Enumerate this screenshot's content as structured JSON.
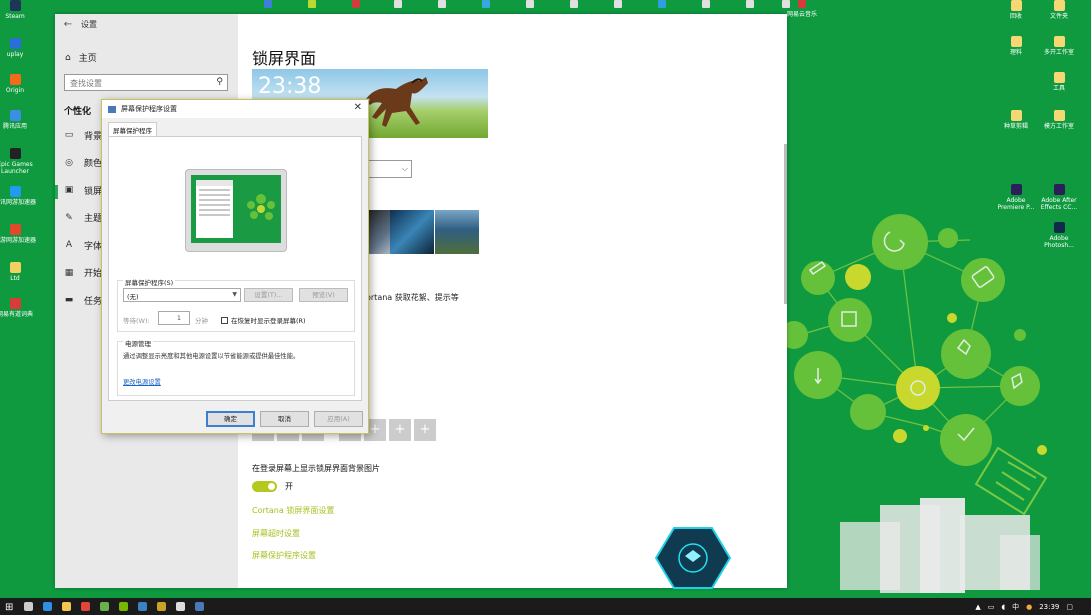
{
  "desktop": {
    "top_icons": [
      {
        "label": "",
        "color": "#3d7fd9"
      },
      {
        "label": "",
        "color": "#bada33"
      },
      {
        "label": "",
        "color": "#d13c3c"
      },
      {
        "label": "",
        "color": "#e0e0e0"
      },
      {
        "label": "",
        "color": "#e0e0e0"
      },
      {
        "label": "",
        "color": "#3aa8e0"
      },
      {
        "label": "",
        "color": "#e0e0e0"
      },
      {
        "label": "",
        "color": "#e0e0e0"
      },
      {
        "label": "",
        "color": "#e0e0e0"
      },
      {
        "label": "",
        "color": "#2f9de0"
      },
      {
        "label": "",
        "color": "#e0e0e0"
      },
      {
        "label": "",
        "color": "#e0e0e0"
      },
      {
        "label": "",
        "color": "#e0e0e0"
      },
      {
        "label": "网易云音乐",
        "color": "#d43c3c"
      }
    ],
    "left_icons": [
      {
        "label": "Steam",
        "color": "#1d3557"
      },
      {
        "label": "uplay",
        "color": "#2a6fd8"
      },
      {
        "label": "Origin",
        "color": "#f36a1b"
      },
      {
        "label": "腾讯应用",
        "color": "#3a8fe3"
      },
      {
        "label": "Epic Games Launcher",
        "color": "#222222"
      },
      {
        "label": "腾讯网游加速器",
        "color": "#1f9cf0"
      },
      {
        "label": "迅游网游加速器",
        "color": "#e04a2a"
      },
      {
        "label": "Ltd",
        "color": "#f1d160"
      },
      {
        "label": "网易有道词典",
        "color": "#d93b3b"
      }
    ],
    "right_icons": [
      {
        "label": "回收",
        "color": "#f5d873"
      },
      {
        "label": "文件夹",
        "color": "#f5d873"
      },
      {
        "label": "理料",
        "color": "#f5d873"
      },
      {
        "label": "多开工作室",
        "color": "#f5d873"
      },
      {
        "label": "工具",
        "color": "#f5d873"
      },
      {
        "label": "种草剪辑",
        "color": "#f5d873"
      },
      {
        "label": "模方工作室",
        "color": "#f5d873"
      },
      {
        "label": "Adobe Premiere P...",
        "color": "#2b1f5a"
      },
      {
        "label": "Adobe After Effects CC...",
        "color": "#2b1f5a"
      },
      {
        "label": "Adobe Photosh...",
        "color": "#0f2a4a"
      }
    ]
  },
  "settings": {
    "window_title": "设置",
    "home": "主页",
    "search_placeholder": "查找设置",
    "section": "个性化",
    "nav": [
      {
        "label": "背景",
        "icon": "image-icon"
      },
      {
        "label": "颜色",
        "icon": "palette-icon"
      },
      {
        "label": "锁屏界面",
        "icon": "lockscreen-icon"
      },
      {
        "label": "主题",
        "icon": "brush-icon"
      },
      {
        "label": "字体",
        "icon": "font-icon"
      },
      {
        "label": "开始",
        "icon": "start-icon"
      },
      {
        "label": "任务栏",
        "icon": "taskbar-icon"
      }
    ],
    "page_title": "锁屏界面",
    "clock": "23:38",
    "cortana_text": "ortana 获取花絮、提示等",
    "login_label": "在登录屏幕上显示锁屏界面背景图片",
    "toggle_text": "开",
    "toggle_on": true,
    "links": [
      "Cortana 锁屏界面设置",
      "屏幕超时设置",
      "屏幕保护程序设置"
    ],
    "accent": "#a8bd1d"
  },
  "dialog": {
    "title": "屏幕保护程序设置",
    "tab": "屏幕保护程序",
    "saver_label": "屏幕保护程序(S)",
    "saver_value": "(无)",
    "settings_button": "设置(T)...",
    "preview_button": "预览(V)",
    "wait_label": "等待(W):",
    "wait_value": "1",
    "minutes_label": "分钟",
    "resume_checkbox": "在恢复时显示登录屏幕(R)",
    "resume_checked": false,
    "power_label": "电源管理",
    "power_text": "通过调整显示亮度和其他电源设置以节省能源或提供最佳性能。",
    "power_link": "更改电源设置",
    "ok": "确定",
    "cancel": "取消",
    "apply": "应用(A)"
  },
  "taskbar": {
    "apps": [
      {
        "name": "task-view-icon",
        "color": "#cccccc"
      },
      {
        "name": "edge-icon",
        "color": "#2f8fe0"
      },
      {
        "name": "file-explorer-icon",
        "color": "#f2c94c"
      },
      {
        "name": "chrome-icon",
        "color": "#e2463a"
      },
      {
        "name": "app-green-icon",
        "color": "#6ab04c"
      },
      {
        "name": "nvidia-icon",
        "color": "#76b900"
      },
      {
        "name": "store-icon",
        "color": "#3b82c4"
      },
      {
        "name": "app-icon",
        "color": "#c9a227"
      },
      {
        "name": "settings-icon",
        "color": "#dddddd"
      },
      {
        "name": "screensaver-icon",
        "color": "#4a79b8"
      }
    ],
    "ime": "中",
    "time": "23:39"
  }
}
